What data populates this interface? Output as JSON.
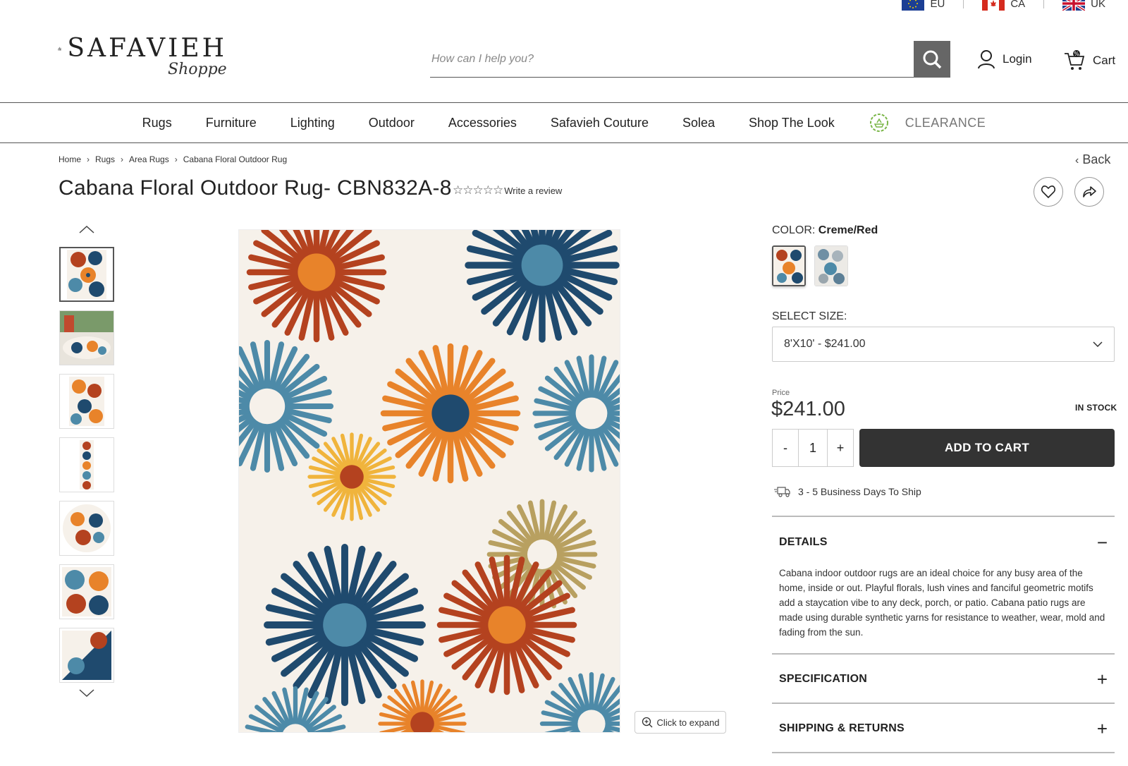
{
  "regions": [
    {
      "code": "EU",
      "icon": "eu-flag-icon"
    },
    {
      "code": "CA",
      "icon": "canada-flag-icon"
    },
    {
      "code": "UK",
      "icon": "uk-flag-icon"
    }
  ],
  "header": {
    "logo_main": "SAFAVIEH",
    "logo_sub": "Shoppe",
    "search_placeholder": "How can I help you?",
    "login_label": "Login",
    "cart_label": "Cart"
  },
  "nav": {
    "items": [
      "Rugs",
      "Furniture",
      "Lighting",
      "Outdoor",
      "Accessories",
      "Safavieh Couture",
      "Solea",
      "Shop The Look"
    ],
    "clearance": "CLEARANCE"
  },
  "breadcrumb": [
    "Home",
    "Rugs",
    "Area Rugs",
    "Cabana Floral Outdoor Rug"
  ],
  "back_label": "Back",
  "product": {
    "title": "Cabana Floral Outdoor Rug- CBN832A-8",
    "stars": "☆☆☆☆☆",
    "review_label": "Write a review",
    "color_label": "COLOR:",
    "color_value": "Creme/Red",
    "size_label": "SELECT SIZE:",
    "size_value": "8'X10' - $241.00",
    "price_label": "Price",
    "price": "$241.00",
    "stock": "IN STOCK",
    "qty_minus": "-",
    "qty": "1",
    "qty_plus": "+",
    "add_to_cart": "ADD TO CART",
    "shipping": "3 - 5 Business Days To Ship",
    "expand_label": "Click to expand"
  },
  "accordion": {
    "details_title": "DETAILS",
    "details_icon": "−",
    "details_text": "Cabana indoor outdoor rugs are an ideal choice for any busy area of the home, inside or out. Playful florals, lush vines and fanciful geometric motifs add a staycation vibe to any deck, porch, or patio. Cabana patio rugs are made using durable synthetic yarns for resistance to weather, wear, mold and fading from the sun.",
    "spec_title": "SPECIFICATION",
    "spec_icon": "+",
    "shipping_title": "SHIPPING & RETURNS",
    "shipping_icon": "+"
  },
  "colors": {
    "rug_cream": "#f6f1ea",
    "rug_red": "#b4421f",
    "rug_orange": "#e8832a",
    "rug_yellow": "#f0b43c",
    "rug_navy": "#1f4a6e",
    "rug_teal": "#4d8aa8",
    "rug_olive": "#b8a060",
    "button_dark": "#333333"
  }
}
